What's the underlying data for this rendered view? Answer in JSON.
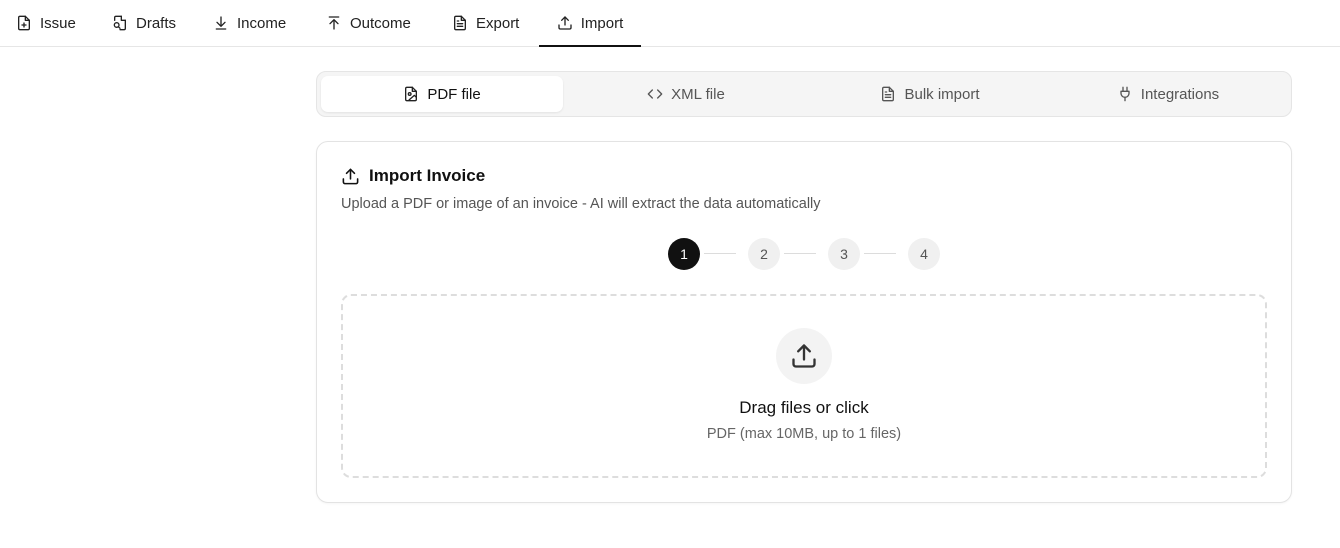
{
  "nav": {
    "tabs": [
      {
        "label": "Issue",
        "icon": "file-plus-icon"
      },
      {
        "label": "Drafts",
        "icon": "file-search-icon"
      },
      {
        "label": "Income",
        "icon": "download-icon"
      },
      {
        "label": "Outcome",
        "icon": "upload-arrow-icon"
      },
      {
        "label": "Export",
        "icon": "file-text-icon"
      },
      {
        "label": "Import",
        "icon": "upload-icon"
      }
    ],
    "active": "Import"
  },
  "source_tabs": {
    "items": [
      {
        "label": "PDF file",
        "icon": "file-image-icon"
      },
      {
        "label": "XML file",
        "icon": "code-icon"
      },
      {
        "label": "Bulk import",
        "icon": "file-text-icon"
      },
      {
        "label": "Integrations",
        "icon": "plug-icon"
      }
    ],
    "active": "PDF file"
  },
  "card": {
    "title": "Import Invoice",
    "subtitle": "Upload a PDF or image of an invoice - AI will extract the data automatically",
    "steps": [
      "1",
      "2",
      "3",
      "4"
    ],
    "current_step": 1
  },
  "dropzone": {
    "title": "Drag files or click",
    "hint": "PDF (max 10MB, up to 1 files)"
  },
  "colors": {
    "accent": "#111111",
    "muted": "#555555",
    "border": "#e5e5e5"
  }
}
